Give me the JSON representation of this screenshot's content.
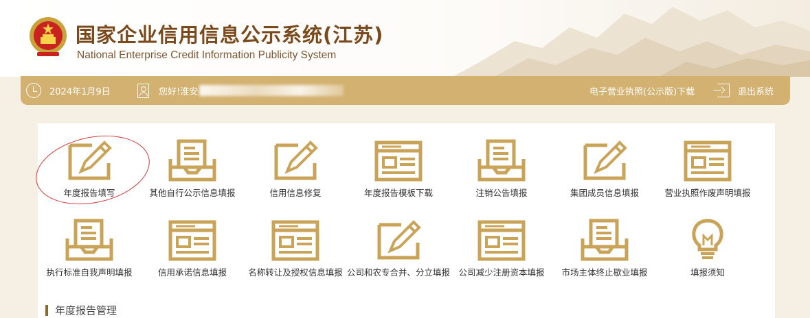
{
  "header": {
    "title_cn": "国家企业信用信息公示系统(江苏)",
    "title_en": "National Enterprise Credit Information Publicity System"
  },
  "topbar": {
    "date": "2024年1月9日",
    "greeting": "您好!淮安",
    "license_link": "电子营业执照(公示版)下载",
    "logout": "退出系统",
    "colors": {
      "bar": "#d3b170",
      "text": "#ffffff"
    }
  },
  "tiles": [
    {
      "label": "年度报告填写",
      "icon": "pencil-icon"
    },
    {
      "label": "其他自行公示信息填报",
      "icon": "tray-icon"
    },
    {
      "label": "信用信息修复",
      "icon": "pencil-icon"
    },
    {
      "label": "年度报告模板下载",
      "icon": "form-icon"
    },
    {
      "label": "注销公告填报",
      "icon": "tray-icon"
    },
    {
      "label": "集团成员信息填报",
      "icon": "pencil-icon"
    },
    {
      "label": "营业执照作废声明填报",
      "icon": "form-icon"
    },
    {
      "label": "执行标准自我声明填报",
      "icon": "tray-icon"
    },
    {
      "label": "信用承诺信息填报",
      "icon": "form-icon"
    },
    {
      "label": "名称转让及授权信息填报",
      "icon": "form-icon"
    },
    {
      "label": "公司和农专合并、分立填报",
      "icon": "pencil-icon"
    },
    {
      "label": "公司减少注册资本填报",
      "icon": "form-icon"
    },
    {
      "label": "市场主体终止歇业填报",
      "icon": "tray-icon"
    },
    {
      "label": "填报须知",
      "icon": "bulb-icon"
    }
  ],
  "section": {
    "title": "年度报告管理"
  },
  "accent_color": "#c9a458"
}
